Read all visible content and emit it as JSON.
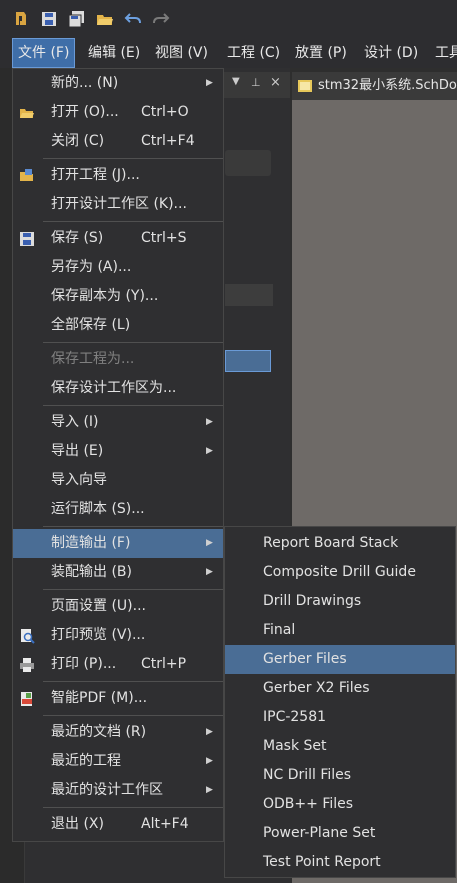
{
  "menubar": {
    "items": [
      "文件 (F)",
      "编辑 (E)",
      "视图 (V)",
      "工程 (C)",
      "放置 (P)",
      "设计 (D)",
      "工具"
    ]
  },
  "doc_tab": {
    "title": "stm32最小系统.SchDoc"
  },
  "file_menu": {
    "items": [
      {
        "label": "新的... (N)",
        "shortcut": "",
        "submenu": true
      },
      {
        "label": "打开 (O)...",
        "shortcut": "Ctrl+O"
      },
      {
        "label": "关闭 (C)",
        "shortcut": "Ctrl+F4"
      },
      {
        "label": "打开工程 (J)...",
        "shortcut": ""
      },
      {
        "label": "打开设计工作区 (K)...",
        "shortcut": ""
      },
      {
        "label": "保存 (S)",
        "shortcut": "Ctrl+S"
      },
      {
        "label": "另存为 (A)...",
        "shortcut": ""
      },
      {
        "label": "保存副本为 (Y)...",
        "shortcut": ""
      },
      {
        "label": "全部保存 (L)",
        "shortcut": ""
      },
      {
        "label": "保存工程为...",
        "shortcut": "",
        "disabled": true
      },
      {
        "label": "保存设计工作区为...",
        "shortcut": ""
      },
      {
        "label": "导入 (I)",
        "shortcut": "",
        "submenu": true
      },
      {
        "label": "导出 (E)",
        "shortcut": "",
        "submenu": true
      },
      {
        "label": "导入向导",
        "shortcut": ""
      },
      {
        "label": "运行脚本 (S)...",
        "shortcut": ""
      },
      {
        "label": "制造输出 (F)",
        "shortcut": "",
        "submenu": true,
        "highlighted": true
      },
      {
        "label": "装配输出 (B)",
        "shortcut": "",
        "submenu": true
      },
      {
        "label": "页面设置 (U)...",
        "shortcut": ""
      },
      {
        "label": "打印预览 (V)...",
        "shortcut": ""
      },
      {
        "label": "打印 (P)...",
        "shortcut": "Ctrl+P"
      },
      {
        "label": "智能PDF (M)...",
        "shortcut": ""
      },
      {
        "label": "最近的文档 (R)",
        "shortcut": "",
        "submenu": true
      },
      {
        "label": "最近的工程",
        "shortcut": "",
        "submenu": true
      },
      {
        "label": "最近的设计工作区",
        "shortcut": "",
        "submenu": true
      },
      {
        "label": "退出 (X)",
        "shortcut": "Alt+F4"
      }
    ]
  },
  "fab_submenu": {
    "items": [
      "Report Board Stack",
      "Composite Drill Guide",
      "Drill Drawings",
      "Final",
      "Gerber Files",
      "Gerber X2 Files",
      "IPC-2581",
      "Mask Set",
      "NC Drill Files",
      "ODB++ Files",
      "Power-Plane Set",
      "Test Point Report"
    ],
    "highlighted_index": 4
  },
  "colors": {
    "highlight": "#4a6d95",
    "accent_active": "#3f6ea8"
  }
}
